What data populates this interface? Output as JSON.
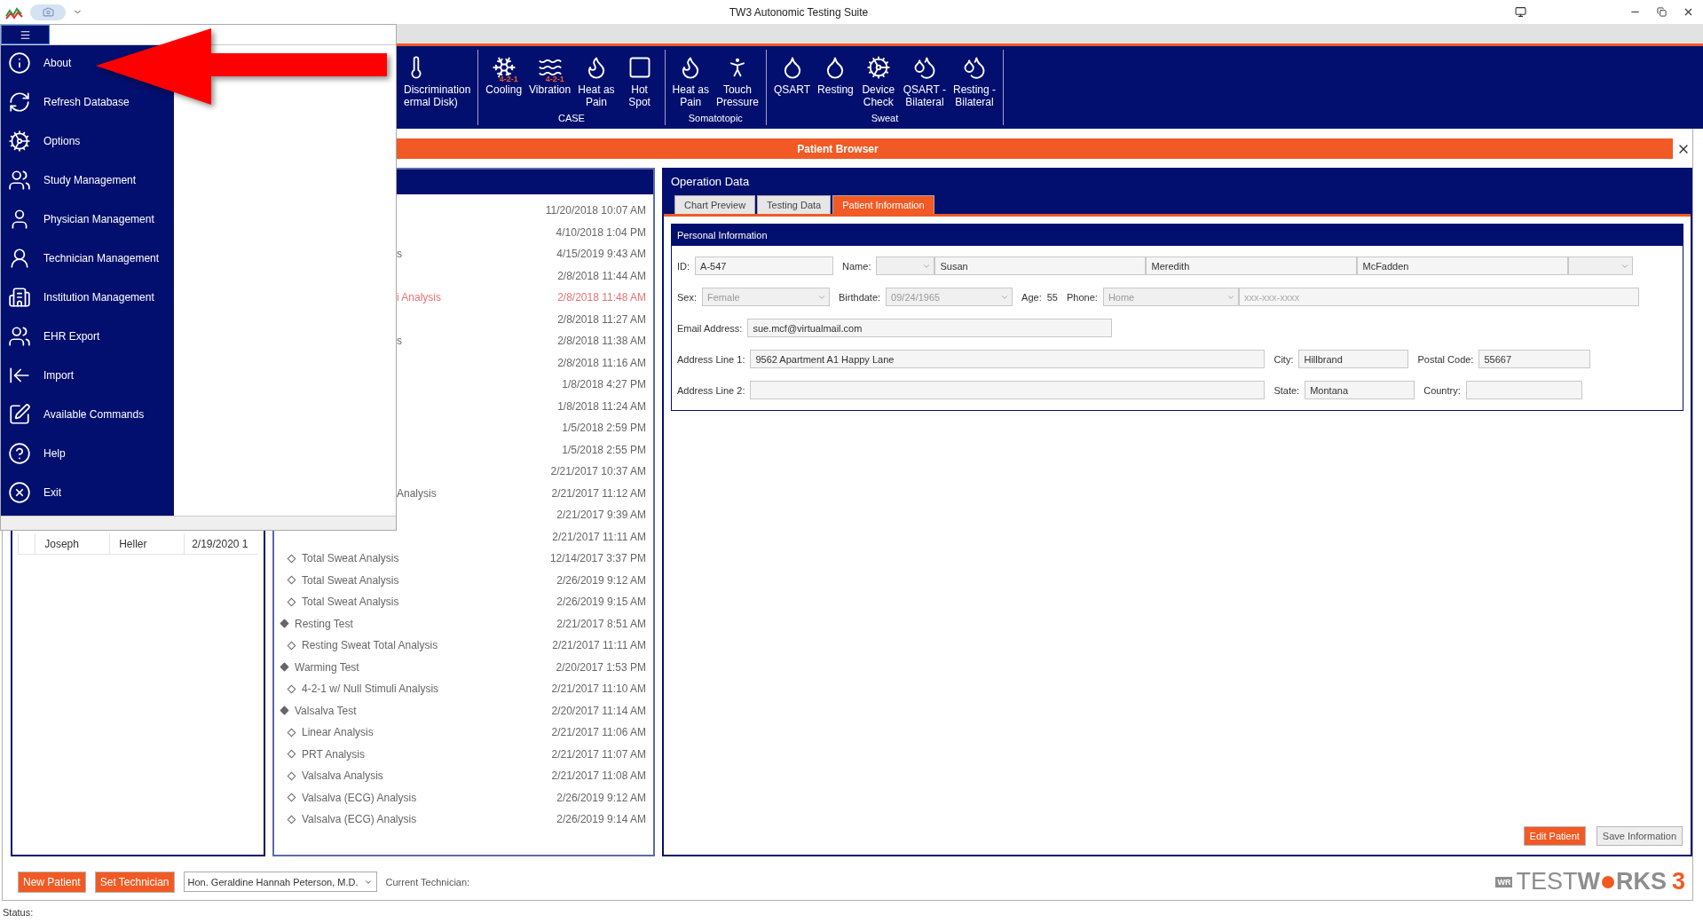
{
  "window": {
    "title": "TW3 Autonomic Testing Suite"
  },
  "app_menu": {
    "items": [
      {
        "label": "About"
      },
      {
        "label": "Refresh Database"
      },
      {
        "label": "Options"
      },
      {
        "label": "Study Management"
      },
      {
        "label": "Physician Management"
      },
      {
        "label": "Technician Management"
      },
      {
        "label": "Institution Management"
      },
      {
        "label": "EHR Export"
      },
      {
        "label": "Import"
      },
      {
        "label": "Available Commands"
      },
      {
        "label": "Help"
      },
      {
        "label": "Exit"
      }
    ]
  },
  "ribbon": {
    "groups": [
      {
        "buttons": [
          {
            "label": "Discrimination\nermal Disk)"
          }
        ]
      },
      {
        "label": "CASE",
        "buttons": [
          {
            "label": "Cooling",
            "badge": "4-2-1"
          },
          {
            "label": "Vibration",
            "badge": "4-2-1"
          },
          {
            "label": "Heat as\nPain"
          },
          {
            "label": "Hot\nSpot"
          }
        ]
      },
      {
        "label": "Somatotopic",
        "buttons": [
          {
            "label": "Heat as\nPain"
          },
          {
            "label": "Touch\nPressure"
          }
        ]
      },
      {
        "label": "Sweat",
        "buttons": [
          {
            "label": "QSART"
          },
          {
            "label": "Resting"
          },
          {
            "label": "Device\nCheck"
          },
          {
            "label": "QSART -\nBilateral"
          },
          {
            "label": "Resting -\nBilateral"
          }
        ]
      }
    ]
  },
  "patient_browser": {
    "title": "Patient Browser"
  },
  "patients": {
    "rows": [
      {
        "cells": [
          "Joseph",
          "Heller",
          "2/19/2020 1"
        ]
      }
    ]
  },
  "tests": {
    "rows": [
      {
        "kind": "hidden",
        "date": "11/20/2018 10:07 AM",
        "flagged": false
      },
      {
        "kind": "hidden",
        "date": "4/10/2018 1:04 PM",
        "flagged": false
      },
      {
        "kind": "hidden",
        "name": "s",
        "date": "4/15/2019 9:43 AM",
        "flagged": false
      },
      {
        "kind": "hidden",
        "date": "2/8/2018 11:44 AM",
        "flagged": false
      },
      {
        "kind": "hidden",
        "name": "i Analysis",
        "date": "2/8/2018 11:48 AM",
        "flagged": true
      },
      {
        "kind": "hidden",
        "date": "2/8/2018 11:27 AM",
        "flagged": false
      },
      {
        "kind": "hidden",
        "name": "s",
        "date": "2/8/2018 11:38 AM",
        "flagged": false
      },
      {
        "kind": "hidden",
        "date": "2/8/2018 11:16 AM",
        "flagged": false
      },
      {
        "kind": "hidden",
        "date": "1/8/2018 4:27 PM",
        "flagged": false
      },
      {
        "kind": "hidden",
        "date": "1/8/2018 11:24 AM",
        "flagged": false
      },
      {
        "kind": "hidden",
        "date": "1/5/2018 2:59 PM",
        "flagged": false
      },
      {
        "kind": "hidden",
        "date": "1/5/2018 2:55 PM",
        "flagged": false
      },
      {
        "kind": "hidden",
        "date": "2/21/2017 10:37 AM",
        "flagged": false
      },
      {
        "kind": "hidden",
        "name": "Analysis",
        "date": "2/21/2017 11:12 AM",
        "flagged": false
      },
      {
        "kind": "hidden",
        "date": "2/21/2017 9:39 AM",
        "flagged": false
      },
      {
        "kind": "hidden",
        "date": "2/21/2017 11:11 AM",
        "flagged": false
      },
      {
        "kind": "analysis",
        "name": "Total Sweat Analysis",
        "date": "12/14/2017 3:37 PM",
        "flagged": false
      },
      {
        "kind": "analysis",
        "name": "Total Sweat Analysis",
        "date": "2/26/2019 9:12 AM",
        "flagged": false
      },
      {
        "kind": "analysis",
        "name": "Total Sweat Analysis",
        "date": "2/26/2019 9:15 AM",
        "flagged": false
      },
      {
        "kind": "test",
        "name": "Resting Test",
        "date": "2/21/2017 8:51 AM",
        "flagged": false
      },
      {
        "kind": "analysis",
        "name": "Resting Sweat Total Analysis",
        "date": "2/21/2017 11:11 AM",
        "flagged": false
      },
      {
        "kind": "test",
        "name": "Warming Test",
        "date": "2/20/2017 1:53 PM",
        "flagged": false
      },
      {
        "kind": "analysis",
        "name": "4-2-1 w/ Null Stimuli Analysis",
        "date": "2/21/2017 11:10 AM",
        "flagged": false
      },
      {
        "kind": "test",
        "name": "Valsalva Test",
        "date": "2/20/2017 11:14 AM",
        "flagged": false
      },
      {
        "kind": "analysis",
        "name": "Linear Analysis",
        "date": "2/21/2017 11:06 AM",
        "flagged": false
      },
      {
        "kind": "analysis",
        "name": "PRT Analysis",
        "date": "2/21/2017 11:07 AM",
        "flagged": false
      },
      {
        "kind": "analysis",
        "name": "Valsalva Analysis",
        "date": "2/21/2017 11:08 AM",
        "flagged": false
      },
      {
        "kind": "analysis",
        "name": "Valsalva (ECG) Analysis",
        "date": "2/26/2019 9:12 AM",
        "flagged": false
      },
      {
        "kind": "analysis",
        "name": "Valsalva (ECG) Analysis",
        "date": "2/26/2019 9:14 AM",
        "flagged": false
      }
    ]
  },
  "operation_data": {
    "title": "Operation Data",
    "tabs": [
      {
        "label": "Chart Preview",
        "selected": false
      },
      {
        "label": "Testing Data",
        "selected": false
      },
      {
        "label": "Patient Information",
        "selected": true
      }
    ],
    "personal_information": {
      "title": "Personal Information",
      "rows": [
        [
          {
            "kind": "label",
            "text": "ID:"
          },
          {
            "kind": "text",
            "value": "A-547"
          },
          {
            "kind": "label",
            "text": "Name:"
          },
          {
            "kind": "select",
            "disabled": true
          },
          {
            "kind": "text",
            "value": "Susan"
          },
          {
            "kind": "text",
            "value": "Meredith"
          },
          {
            "kind": "text",
            "value": "McFadden"
          },
          {
            "kind": "select",
            "disabled": true
          }
        ],
        [
          {
            "kind": "label",
            "text": "Sex:"
          },
          {
            "kind": "select",
            "value": "Female",
            "disabled": true
          },
          {
            "kind": "label",
            "text": "Birthdate:"
          },
          {
            "kind": "select",
            "value": "09/24/1965",
            "disabled": true
          },
          {
            "kind": "label",
            "text": "Age:"
          },
          {
            "kind": "value",
            "text": "55"
          },
          {
            "kind": "label",
            "text": "Phone:"
          },
          {
            "kind": "select",
            "value": "Home",
            "disabled": true
          },
          {
            "kind": "text",
            "placeholder": "xxx-xxx-xxxx"
          }
        ],
        [
          {
            "kind": "label",
            "text": "Email Address:"
          },
          {
            "kind": "text",
            "value": "sue.mcf@virtualmail.com"
          }
        ],
        [
          {
            "kind": "label",
            "text": "Address Line 1:"
          },
          {
            "kind": "text",
            "value": "9562 Apartment A1 Happy Lane"
          },
          {
            "kind": "label",
            "text": "City:"
          },
          {
            "kind": "text",
            "value": "Hillbrand"
          },
          {
            "kind": "label",
            "text": "Postal Code:"
          },
          {
            "kind": "text",
            "value": "55667"
          }
        ],
        [
          {
            "kind": "label",
            "text": "Address Line 2:"
          },
          {
            "kind": "text"
          },
          {
            "kind": "label",
            "text": "State:"
          },
          {
            "kind": "text",
            "value": "Montana"
          },
          {
            "kind": "label",
            "text": "Country:"
          },
          {
            "kind": "text"
          }
        ]
      ]
    },
    "buttons": [
      {
        "label": "Edit Patient",
        "primary": true
      },
      {
        "label": "Save Information",
        "primary": false
      }
    ]
  },
  "footer": {
    "buttons": [
      {
        "label": "New Patient"
      },
      {
        "label": "Set Technician"
      }
    ],
    "physician": {
      "value": "Hon. Geraldine Hannah Peterson, M.D."
    },
    "technician_label": "Current Technician:"
  },
  "logo": {
    "badge": "WR",
    "light": "TEST",
    "bold_start": "W",
    "bold_end": "RKS",
    "number": "3"
  },
  "status_bar": {
    "label": "Status:"
  }
}
